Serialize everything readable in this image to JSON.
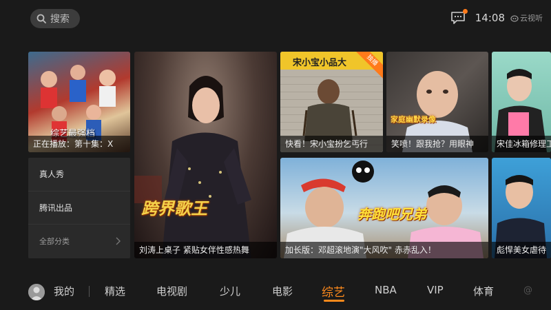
{
  "header": {
    "search_label": "搜索",
    "time": "14:08",
    "brand": "云视听"
  },
  "tiles": {
    "t1_caption": "正在播放：第十集：X",
    "t1_overlay": "综艺最强档",
    "t2_caption": "刘涛上桌子 紧贴女伴性感热舞",
    "t2_logo": "跨界歌王",
    "t3_caption": "快看！宋小宝扮乞丐行",
    "t3_banner": "宋小宝小品大",
    "t3_ribbon": "独播",
    "t4_caption": "笑喷！跟我抢？用眼神",
    "t4_logo": "家庭幽默录像",
    "t5_caption": "宋佳冰箱修理工",
    "t6_caption": "加长版：邓超滚地演\"大风吹\" 赤赤乱入！",
    "t6_logo": "奔跑吧兄弟",
    "t7_caption": "彪悍美女虐待"
  },
  "menu": {
    "items": [
      "真人秀",
      "腾讯出品",
      "全部分类"
    ]
  },
  "nav": {
    "profile": "我的",
    "tabs": [
      "精选",
      "电视剧",
      "少儿",
      "电影",
      "综艺",
      "NBA",
      "VIP",
      "体育"
    ],
    "active": "综艺"
  },
  "colors": {
    "accent": "#ff8a1c",
    "background": "#1a1a1a"
  }
}
